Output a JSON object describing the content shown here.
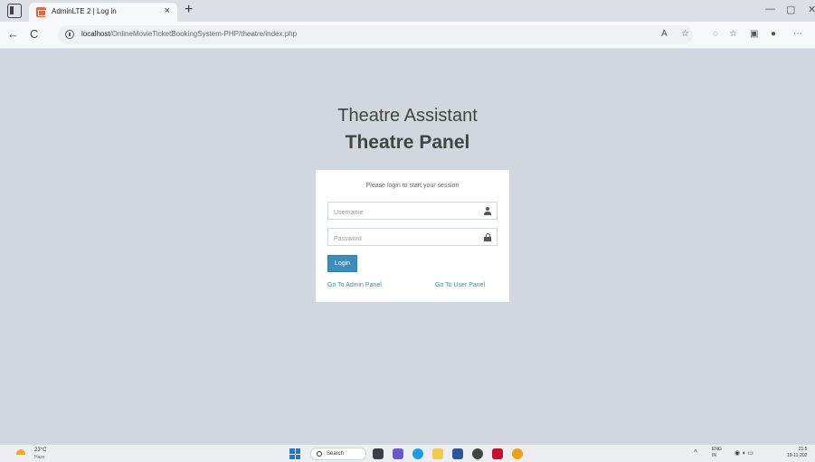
{
  "browser": {
    "tab_title": "AdminLTE 2 | Log in",
    "tab_close": "×",
    "new_tab": "+",
    "url_host": "localhost",
    "url_path": "/OnlineMovieTicketBookingSystem-PHP/theatre/index.php",
    "back": "←",
    "refresh": "C",
    "minimize": "—",
    "restore": "▢"
  },
  "page": {
    "logo_small": "Theatre Assistant",
    "logo_big": "Theatre Panel",
    "login_msg": "Please login to start your session",
    "username_placeholder": "Username",
    "password_placeholder": "Password",
    "login_button": "Login",
    "admin_link": "Go To Admin Panel",
    "user_link": "Go To User Panel"
  },
  "taskbar": {
    "temperature": "23°C",
    "weather": "Haze",
    "search": "Search",
    "language": "ENG",
    "language_region": "IN",
    "time": "21:5",
    "date": "19-11-202"
  },
  "colors": {
    "page_background": "#d2d6de",
    "accent": "#3c8dbc"
  }
}
